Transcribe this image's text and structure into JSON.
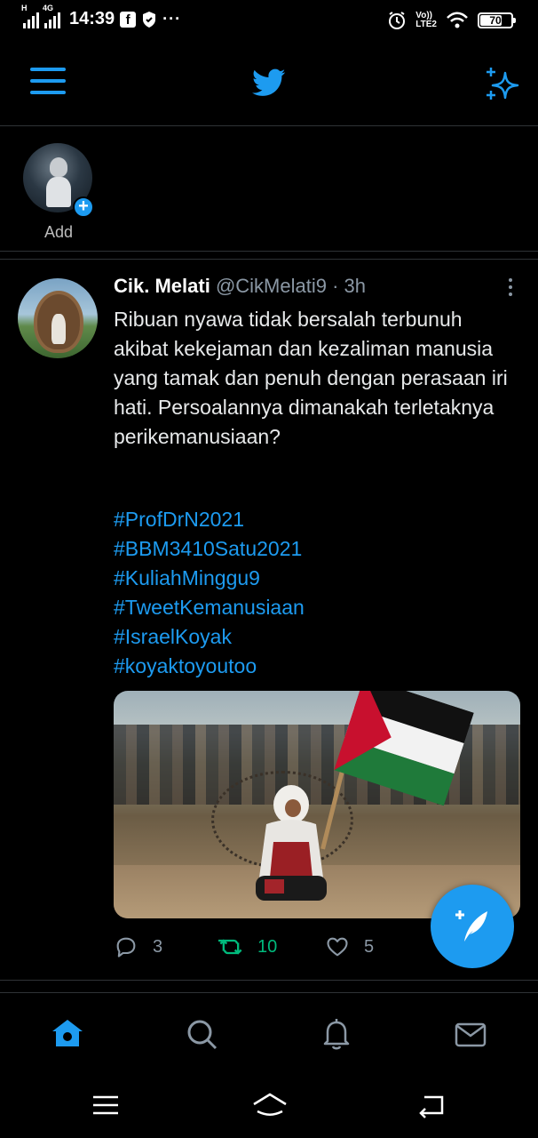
{
  "status_bar": {
    "time": "14:39",
    "signal1_tag": "H",
    "signal2_tag": "4G",
    "volte_label": "Vo))",
    "lte_label": "LTE2",
    "battery_level": "70",
    "battery_fraction": 0.7,
    "overflow": "···"
  },
  "app_bar": {
    "menu_icon": "hamburger-menu-icon",
    "logo_icon": "twitter-bird-icon",
    "sparkle_icon": "sparkle-icon",
    "accent_color": "#1d9bf0"
  },
  "fleets": {
    "add_label": "Add",
    "add_icon": "plus-icon"
  },
  "tweet": {
    "display_name": "Cik. Melati",
    "handle": "@CikMelati9",
    "separator": "·",
    "time_ago": "3h",
    "text": "Ribuan nyawa tidak bersalah terbunuh akibat kekejaman dan kezaliman manusia yang tamak dan penuh dengan perasaan iri hati. Persoalannya dimanakah terletaknya perikemanusiaan?",
    "hashtags": [
      "#ProfDrN2021",
      "#BBM3410Satu2021",
      "#KuliahMinggu9",
      "#TweetKemanusiaan",
      "#IsraelKoyak",
      "#koyaktoyoutoo"
    ],
    "replies": "3",
    "retweets": "10",
    "likes": "5",
    "retweet_color": "#00ba7c"
  },
  "compose_icon": "compose-feather-icon",
  "bottom_nav": [
    "home-icon",
    "search-icon",
    "notifications-icon",
    "messages-icon"
  ],
  "system_nav": [
    "recents-icon",
    "home-button-icon",
    "back-icon"
  ]
}
